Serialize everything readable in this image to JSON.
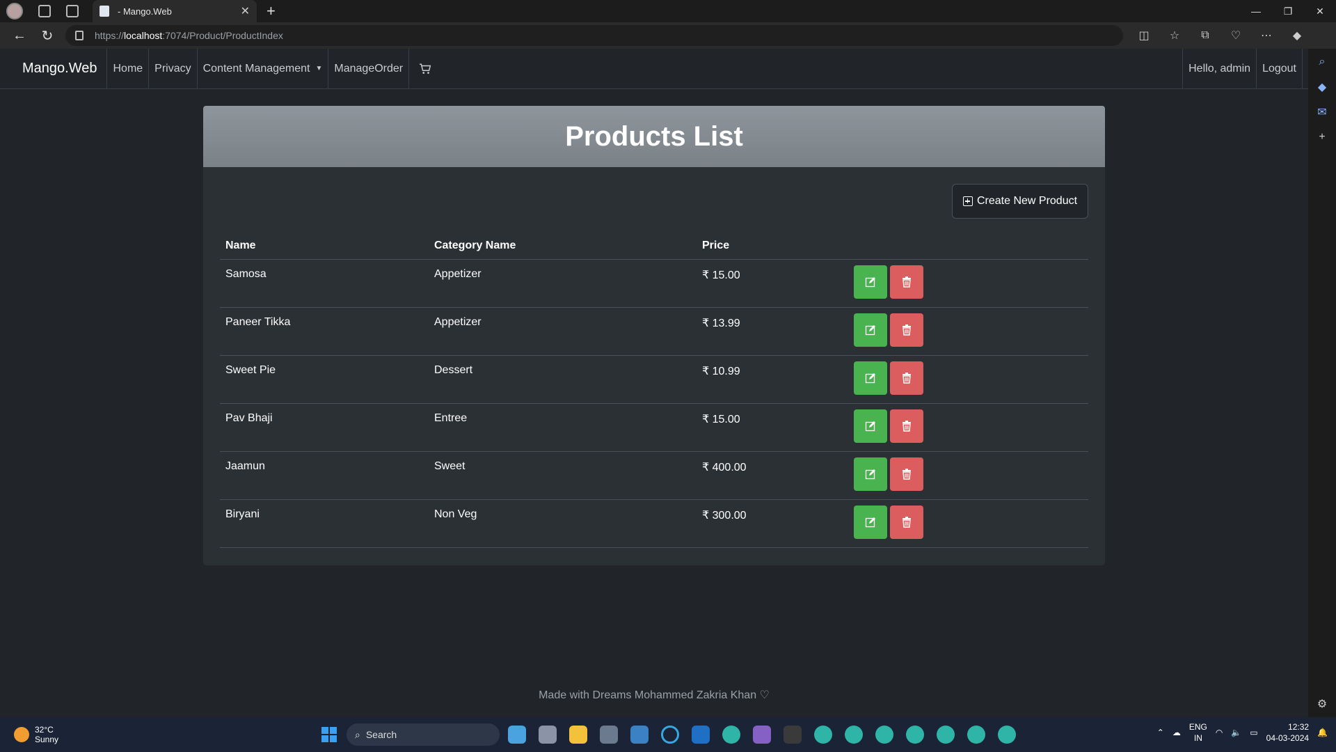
{
  "browser": {
    "tab_title": "- Mango.Web",
    "url_scheme": "https://",
    "url_host": "localhost",
    "url_path": ":7074/Product/ProductIndex"
  },
  "navbar": {
    "brand": "Mango.Web",
    "home": "Home",
    "privacy": "Privacy",
    "content_management": "Content Management",
    "manage_order": "ManageOrder",
    "greeting": "Hello, admin",
    "logout": "Logout"
  },
  "page": {
    "title": "Products List",
    "create_button": "Create New Product",
    "columns": [
      "Name",
      "Category Name",
      "Price"
    ],
    "products": [
      {
        "name": "Samosa",
        "category": "Appetizer",
        "price": "₹ 15.00"
      },
      {
        "name": "Paneer Tikka",
        "category": "Appetizer",
        "price": "₹ 13.99"
      },
      {
        "name": "Sweet Pie",
        "category": "Dessert",
        "price": "₹ 10.99"
      },
      {
        "name": "Pav Bhaji",
        "category": "Entree",
        "price": "₹ 15.00"
      },
      {
        "name": "Jaamun",
        "category": "Sweet",
        "price": "₹ 400.00"
      },
      {
        "name": "Biryani",
        "category": "Non Veg",
        "price": "₹ 300.00"
      }
    ],
    "footer": "Made with Dreams Mohammed Zakria Khan ♡"
  },
  "colors": {
    "edit_button": "#49b34f",
    "delete_button": "#dc5d5d",
    "header_band": "#8e959c"
  },
  "taskbar": {
    "temperature": "32°C",
    "weather": "Sunny",
    "search_placeholder": "Search",
    "lang_top": "ENG",
    "lang_bottom": "IN",
    "time": "12:32",
    "date": "04-03-2024"
  }
}
